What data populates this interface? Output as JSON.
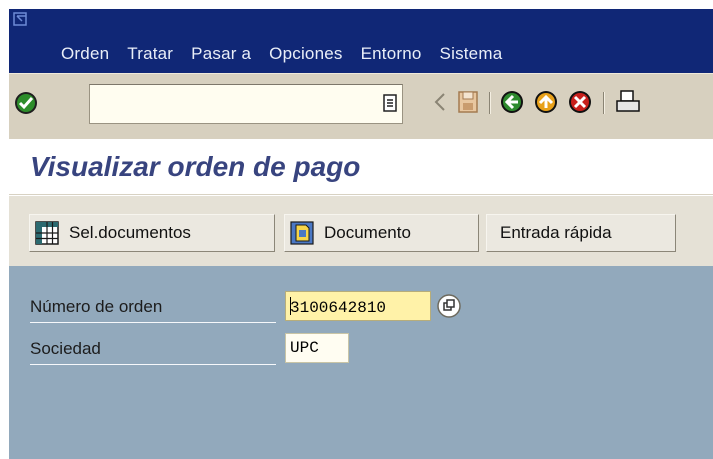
{
  "menu": {
    "items": [
      {
        "label": "Orden"
      },
      {
        "label": "Tratar"
      },
      {
        "label": "Pasar a"
      },
      {
        "label": "Opciones"
      },
      {
        "label": "Entorno"
      },
      {
        "label": "Sistema"
      }
    ]
  },
  "toolbar": {
    "command_field_value": "",
    "icons": [
      "enter-check-icon",
      "command-dropdown-icon",
      "back-arrow-icon",
      "save-icon",
      "back-icon",
      "exit-icon",
      "cancel-icon",
      "print-icon"
    ]
  },
  "page": {
    "title": "Visualizar orden de pago"
  },
  "app_toolbar": {
    "sel_documentos_label": "Sel.documentos",
    "documento_label": "Documento",
    "entrada_rapida_label": "Entrada rápida"
  },
  "form": {
    "numero_orden_label": "Número de orden",
    "numero_orden_value": "3100642810",
    "sociedad_label": "Sociedad",
    "sociedad_value": "UPC"
  },
  "colors": {
    "menubar": "#102776",
    "toolbar": "#d7d0bf",
    "title": "#38447f",
    "work_area": "#92a9bc",
    "focus_field": "#fff2a8"
  }
}
